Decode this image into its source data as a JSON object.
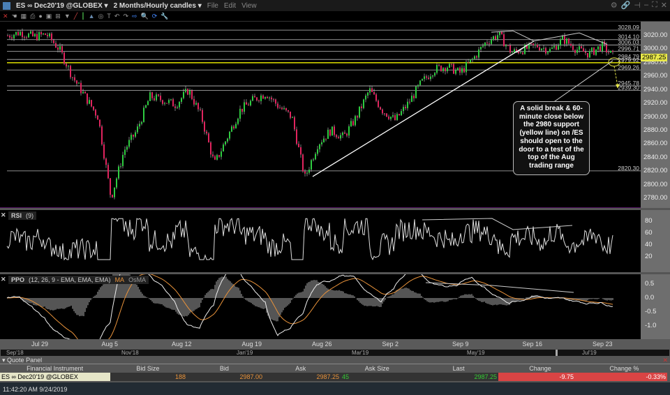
{
  "title": {
    "symbol": "ES ∞ Dec20'19 @GLOBEX",
    "period": "2 Months/Hourly candles",
    "menu": [
      "File",
      "Edit",
      "View"
    ]
  },
  "price_axis": {
    "ticks": [
      3020,
      3000,
      2980,
      2960,
      2940,
      2920,
      2900,
      2880,
      2860,
      2840,
      2820,
      2800,
      2780
    ],
    "last": "2987.25"
  },
  "levels": [
    {
      "value": "3028.09"
    },
    {
      "value": "3014.10"
    },
    {
      "value": "3006.03"
    },
    {
      "value": "2996.71"
    },
    {
      "value": "2984.79"
    },
    {
      "value": "2979.92",
      "color": "#e0e000"
    },
    {
      "value": "2969.26"
    },
    {
      "value": "2945.78"
    },
    {
      "value": "2939.30"
    },
    {
      "value": "2820.30"
    }
  ],
  "price_series": [
    3020,
    3025,
    3018,
    3022,
    3000,
    2960,
    2930,
    2900,
    2780,
    2850,
    2880,
    2930,
    2925,
    2918,
    2940,
    2900,
    2830,
    2870,
    2910,
    2925,
    2935,
    2915,
    2900,
    2810,
    2860,
    2880,
    2870,
    2900,
    2940,
    2910,
    2895,
    2920,
    2950,
    2970,
    2975,
    2965,
    2985,
    3010,
    3022,
    2995,
    3000,
    3005,
    2998,
    3015,
    3000,
    2993,
    3005,
    2987
  ],
  "callout": "A solid break & 60-minute close below the 2980 support (yellow line) on /ES should open to the door to a test of the top of the Aug trading range",
  "rsi": {
    "label": "RSI",
    "param": "(9)",
    "ticks": [
      80,
      60,
      40,
      20
    ]
  },
  "ppo": {
    "label": "PPO",
    "params": "(12, 26, 9 - EMA, EMA, EMA)",
    "ma": "MA",
    "osma": "OsMA",
    "ticks": [
      "0.5",
      "0.0",
      "-0.5",
      "-1.0"
    ]
  },
  "dates": [
    "Jul 29",
    "Aug 5",
    "Aug 12",
    "Aug 19",
    "Aug 26",
    "Sep 2",
    "Sep 9",
    "Sep 16",
    "Sep 23"
  ],
  "scroller": [
    "Sep'18",
    "Nov'18",
    "Jan'19",
    "Mar'19",
    "May'19",
    "Jul'19"
  ],
  "quote": {
    "title": "Quote Panel",
    "columns": [
      "Financial Instrument",
      "Bid Size",
      "Bid",
      "Ask",
      "Ask Size",
      "Last",
      "Change",
      "Change %"
    ],
    "row": {
      "instrument": "ES ∞ Dec20'19 @GLOBEX",
      "bid_size": "188",
      "bid": "2987.00",
      "ask": "2987.25",
      "ask_size": "45",
      "last": "2987.25",
      "change": "-9.75",
      "change_pct": "-0.33%"
    }
  },
  "status": "11:42:20 AM 9/24/2019"
}
